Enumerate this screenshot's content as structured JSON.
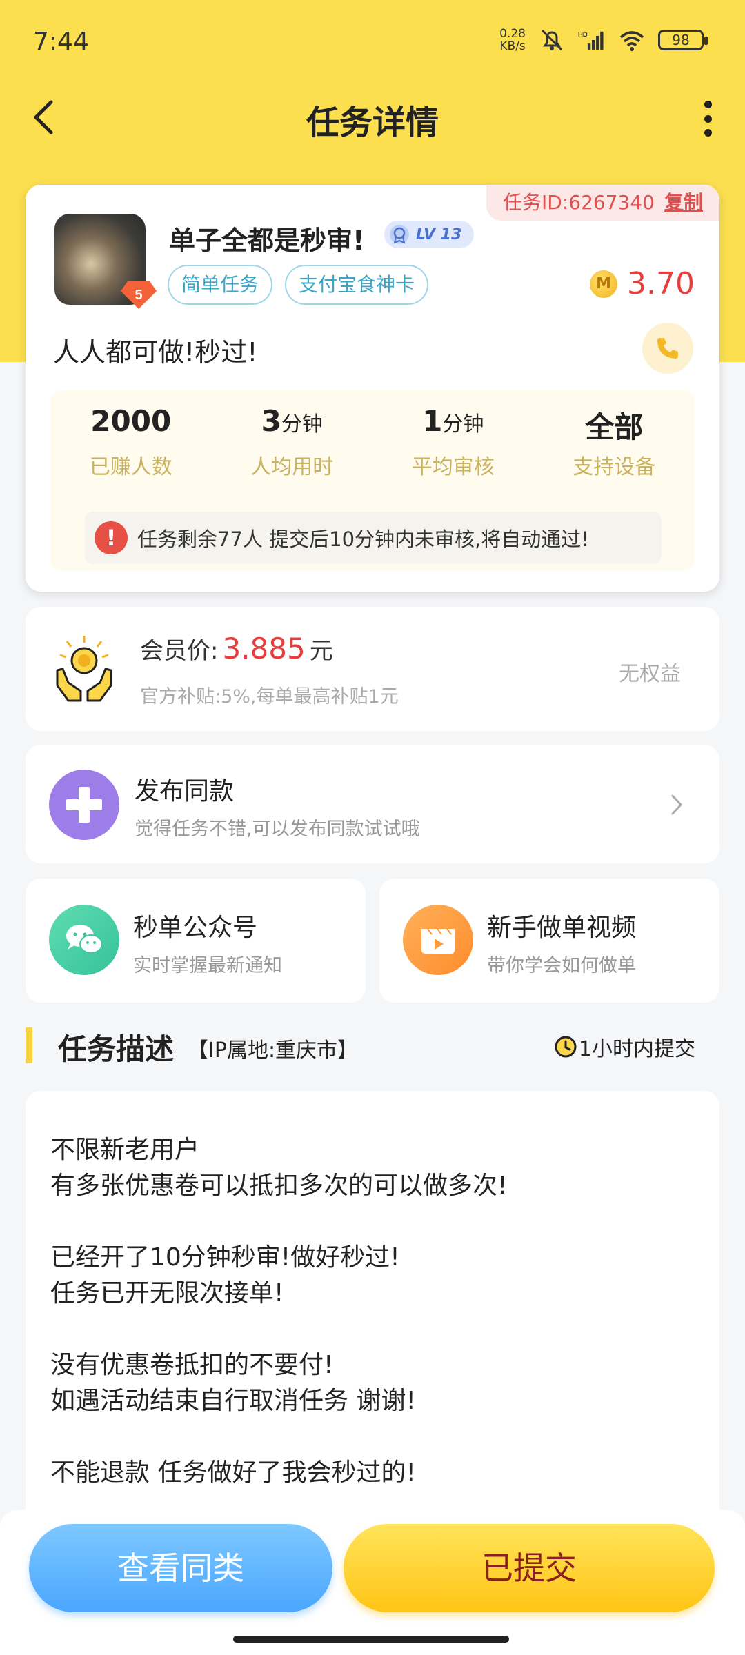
{
  "status_bar": {
    "time": "7:44",
    "net_speed_value": "0.28",
    "net_speed_unit": "KB/s",
    "signal_label": "HD",
    "battery": "98"
  },
  "nav": {
    "title": "任务详情"
  },
  "task": {
    "id_label": "任务ID:6267340",
    "copy_label": "复制",
    "title": "单子全都是秒审!",
    "level": "LV 13",
    "tags": [
      "简单任务",
      "支付宝食神卡"
    ],
    "price": "3.70",
    "coin_label": "M",
    "subtitle": "人人都可做!秒过!",
    "stats": [
      {
        "value": "2000",
        "unit": "",
        "label": "已赚人数"
      },
      {
        "value": "3",
        "unit": "分钟",
        "label": "人均用时"
      },
      {
        "value": "1",
        "unit": "分钟",
        "label": "平均审核"
      },
      {
        "value": "全部",
        "unit": "",
        "label": "支持设备"
      }
    ],
    "notice": "任务剩余77人  提交后10分钟内未审核,将自动通过!"
  },
  "member": {
    "price_label": "会员价:",
    "price_value": "3.885",
    "price_unit": "元",
    "subsidy": "官方补贴:5%,每单最高补贴1元",
    "rights": "无权益"
  },
  "publish": {
    "title": "发布同款",
    "subtitle": "觉得任务不错,可以发布同款试试哦"
  },
  "wechat": {
    "title": "秒单公众号",
    "subtitle": "实时掌握最新通知"
  },
  "video": {
    "title": "新手做单视频",
    "subtitle": "带你学会如何做单"
  },
  "description": {
    "title": "任务描述",
    "ip": "【IP属地:重庆市】",
    "deadline": "1小时内提交",
    "lines": [
      "不限新老用户",
      "有多张优惠卷可以抵扣多次的可以做多次!",
      "",
      "已经开了10分钟秒审!做好秒过!",
      "任务已开无限次接单!",
      "",
      "没有优惠卷抵扣的不要付!",
      "如遇活动结束自行取消任务 谢谢!",
      "",
      "不能退款 任务做好了我会秒过的!"
    ]
  },
  "bottom": {
    "similar_label": "查看同类",
    "submitted_label": "已提交"
  },
  "colors": {
    "brand_yellow": "#fbdf4f",
    "price_red": "#e83d3d",
    "tag_blue": "#3aa6c8"
  }
}
